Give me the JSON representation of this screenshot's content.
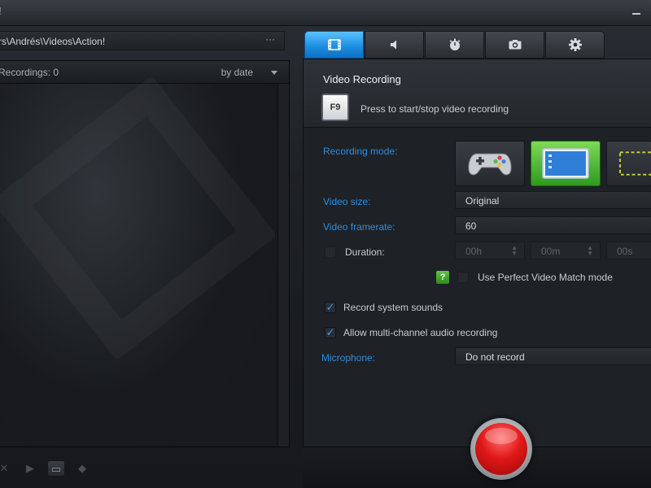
{
  "window": {
    "title": "!"
  },
  "left": {
    "path": "rs\\Andrés\\Videos\\Action!",
    "browse_label": "···",
    "recordings_count": "Recordings: 0",
    "sort_label": "by date"
  },
  "bottom_tools": {
    "close": "✕",
    "play": "▶",
    "folder": "▭",
    "upload": "◆"
  },
  "tabs": [
    {
      "id": "video",
      "icon": "film-icon",
      "active": true
    },
    {
      "id": "audio",
      "icon": "speaker-icon",
      "active": false
    },
    {
      "id": "benchmark",
      "icon": "stopwatch-icon",
      "active": false
    },
    {
      "id": "screenshot",
      "icon": "camera-icon",
      "active": false
    },
    {
      "id": "settings",
      "icon": "gear-icon",
      "active": false
    }
  ],
  "video_recording": {
    "title": "Video Recording",
    "hotkey": "F9",
    "hotkey_desc": "Press to start/stop video recording",
    "recording_mode_label": "Recording mode:",
    "modes": [
      "gamepad-icon",
      "desktop-icon",
      "region-icon"
    ],
    "active_mode": "desktop-icon",
    "video_size_label": "Video size:",
    "video_size_value": "Original",
    "framerate_label": "Video framerate:",
    "framerate_value": "60",
    "duration_label": "Duration:",
    "duration_hours": "00h",
    "duration_minutes": "00m",
    "duration_seconds": "00s",
    "help_badge": "?",
    "perfect_match_label": "Use Perfect Video Match mode",
    "record_system_sounds_label": "Record system sounds",
    "record_system_sounds": true,
    "multichannel_label": "Allow multi-channel audio recording",
    "multichannel": true,
    "microphone_label": "Microphone:",
    "microphone_value": "Do not record"
  },
  "colors": {
    "accent": "#2b8fe0",
    "active_tab": "#1a8be0",
    "active_mode": "#4fb832",
    "record": "#e01818"
  }
}
